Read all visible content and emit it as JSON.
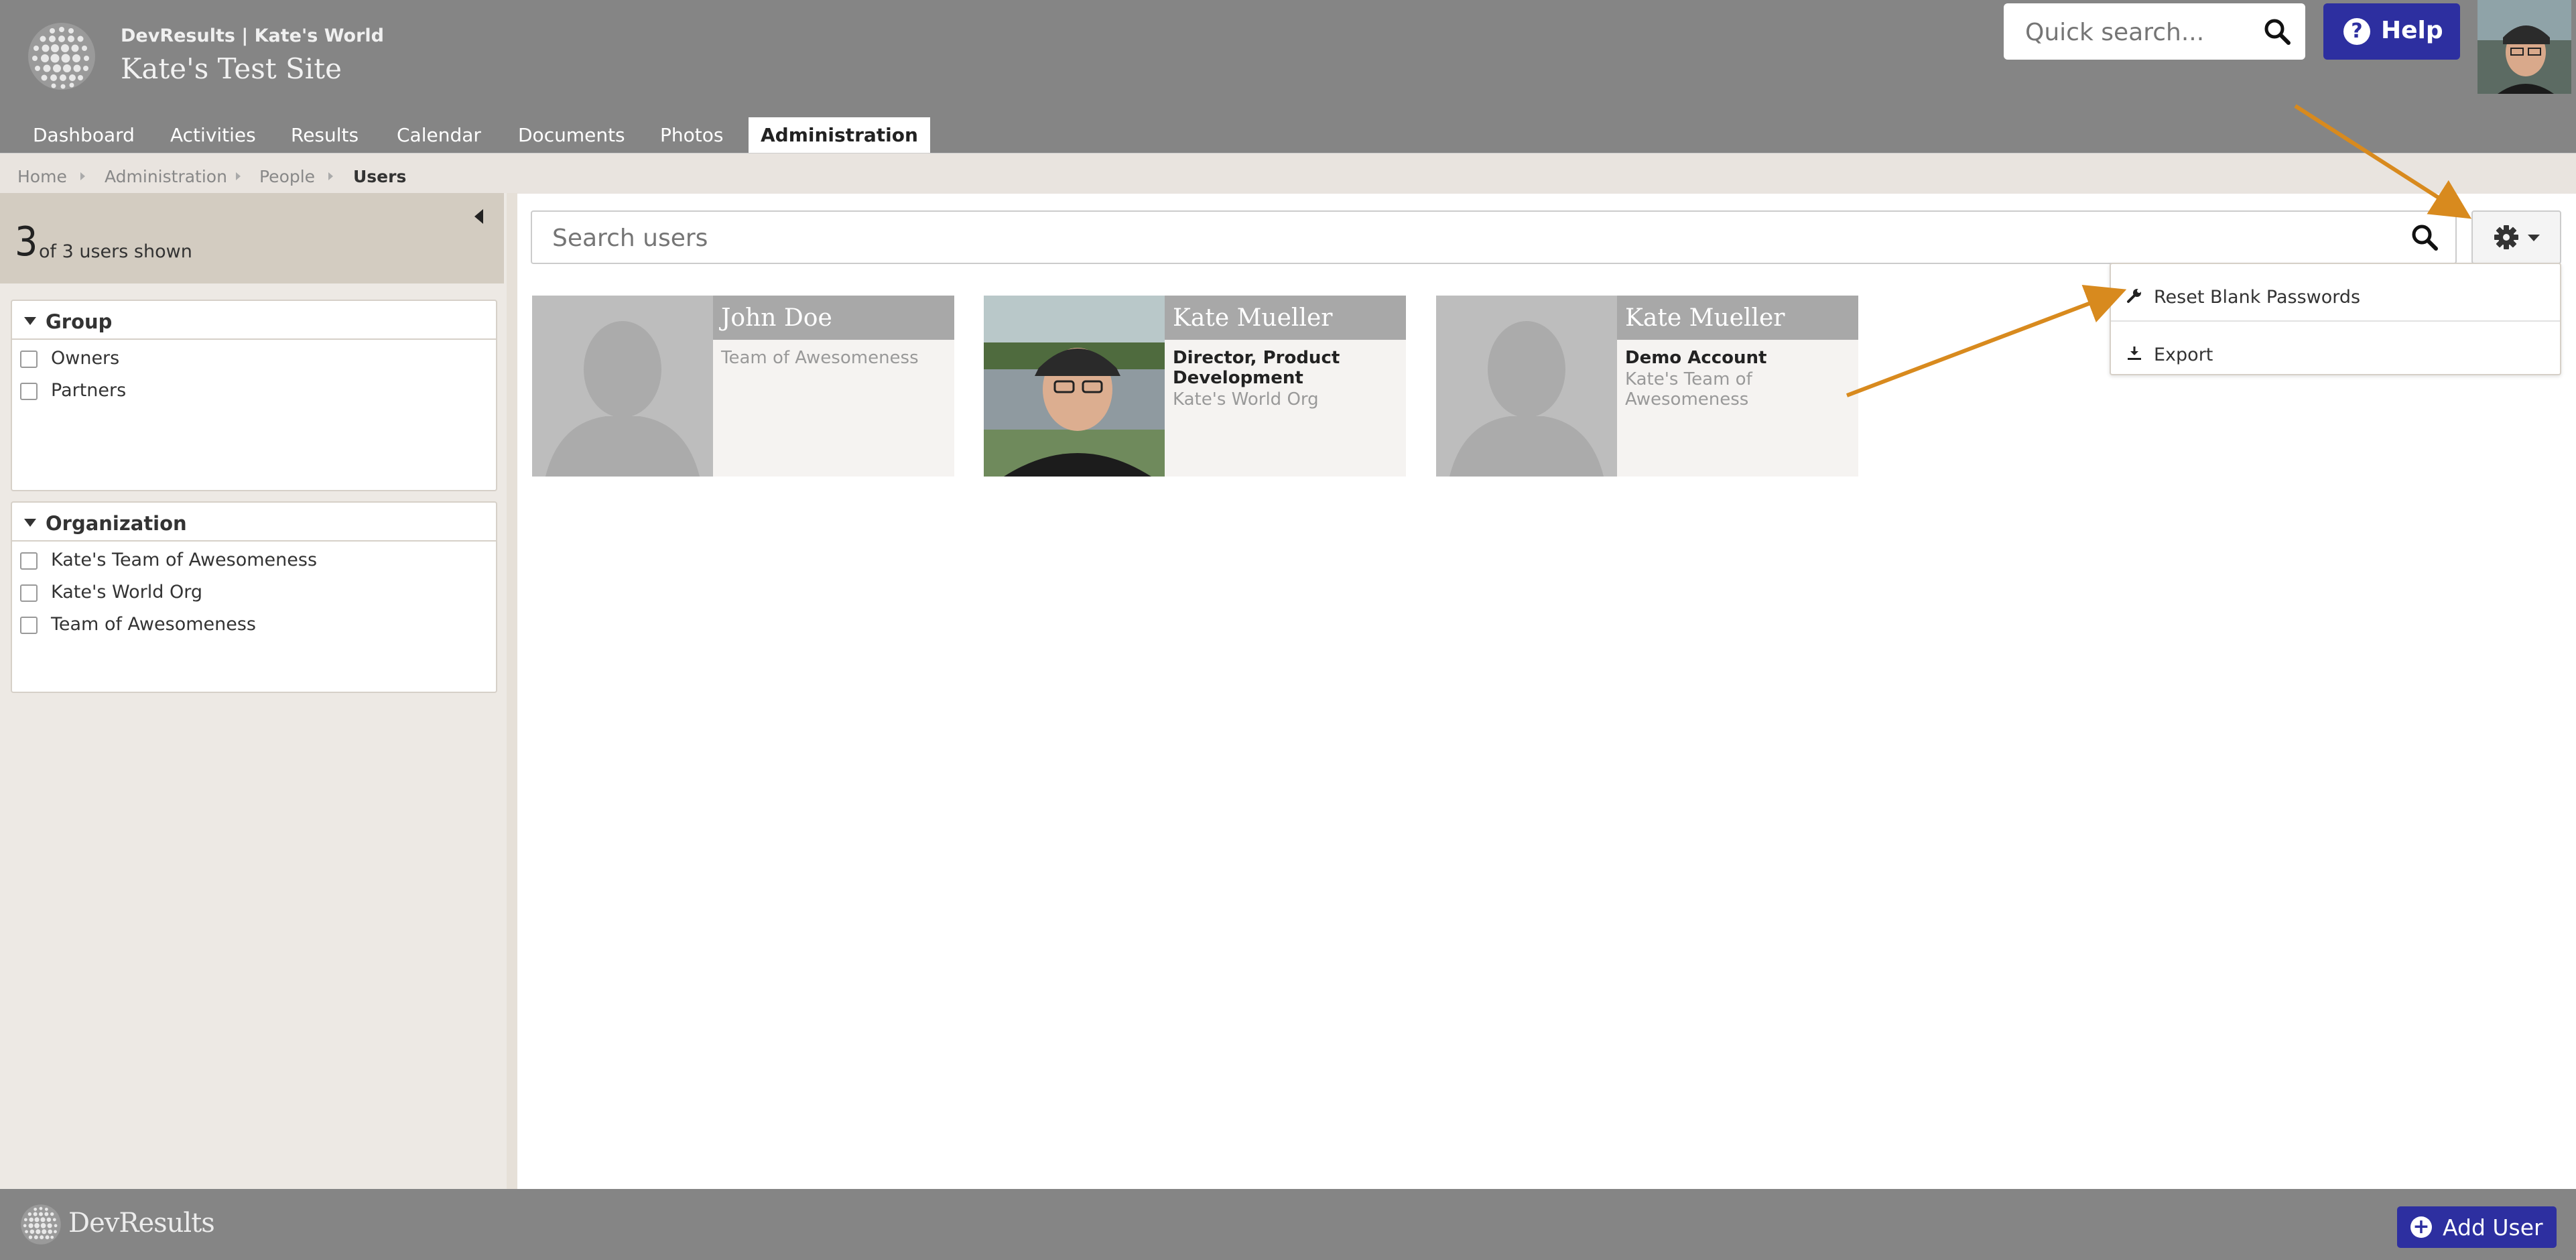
{
  "header": {
    "org_line": "DevResults | Kate's World",
    "site_title": "Kate's Test Site",
    "quick_search_placeholder": "Quick search...",
    "help_label": "Help"
  },
  "nav": {
    "tabs": [
      {
        "label": "Dashboard",
        "active": false
      },
      {
        "label": "Activities",
        "active": false
      },
      {
        "label": "Results",
        "active": false
      },
      {
        "label": "Calendar",
        "active": false
      },
      {
        "label": "Documents",
        "active": false
      },
      {
        "label": "Photos",
        "active": false
      },
      {
        "label": "Administration",
        "active": true
      }
    ]
  },
  "breadcrumb": [
    "Home",
    "Administration",
    "People",
    "Users"
  ],
  "sidebar": {
    "count_shown": "3",
    "count_text": "of 3 users shown",
    "filters": [
      {
        "title": "Group",
        "options": [
          "Owners",
          "Partners"
        ]
      },
      {
        "title": "Organization",
        "options": [
          "Kate's Team of Awesomeness",
          "Kate's World Org",
          "Team of Awesomeness"
        ]
      }
    ]
  },
  "main": {
    "search_placeholder": "Search users",
    "settings_menu": [
      {
        "label": "Reset Blank Passwords",
        "icon": "wrench-icon"
      },
      {
        "label": "Export",
        "icon": "download-icon"
      }
    ],
    "users": [
      {
        "name": "John Doe",
        "title": "",
        "org": "Team of Awesomeness",
        "photo": "placeholder"
      },
      {
        "name": "Kate Mueller",
        "title": "Director, Product Development",
        "org": "Kate's World Org",
        "photo": "portrait"
      },
      {
        "name": "Kate Mueller",
        "title": "Demo Account",
        "org": "Kate's Team of Awesomeness",
        "photo": "placeholder"
      }
    ]
  },
  "footer": {
    "brand": "DevResults",
    "add_user_label": "Add User"
  },
  "colors": {
    "header_bg": "#858585",
    "accent_button": "#2d2fa0",
    "annotation_arrow": "#d88a1e",
    "sidebar_count_bg": "#d3ccc1"
  }
}
